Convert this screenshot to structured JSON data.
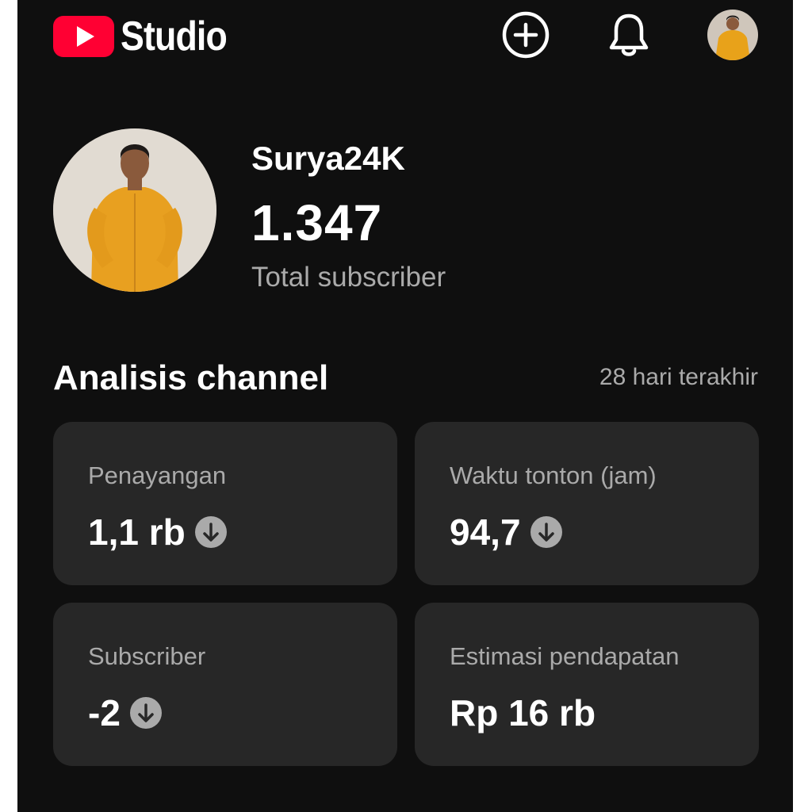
{
  "header": {
    "logo_text": "Studio",
    "create_icon": "plus-circle-icon",
    "notification_icon": "bell-icon",
    "brand_color": "#ff0033"
  },
  "channel": {
    "name": "Surya24K",
    "subscribers": "1.347",
    "subscribers_label": "Total subscriber"
  },
  "analytics": {
    "title": "Analisis channel",
    "period": "28 hari terakhir",
    "cards": [
      {
        "label": "Penayangan",
        "value": "1,1 rb",
        "trend_icon": "arrow-down-circle-icon"
      },
      {
        "label": "Waktu tonton (jam)",
        "value": "94,7",
        "trend_icon": "arrow-down-circle-icon"
      },
      {
        "label": "Subscriber",
        "value": "-2",
        "trend_icon": "arrow-down-circle-icon"
      },
      {
        "label": "Estimasi pendapatan",
        "value": "Rp 16 rb"
      }
    ]
  }
}
